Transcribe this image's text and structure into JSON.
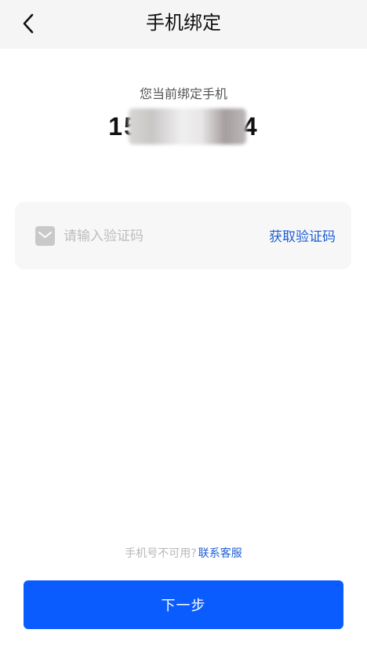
{
  "header": {
    "title": "手机绑定",
    "back_icon": "chevron-left-icon"
  },
  "bound_phone": {
    "label": "您当前绑定手机",
    "number_prefix": "15",
    "number_suffix": "4",
    "masked_icon": "blurred-redaction"
  },
  "verification": {
    "icon": "mail-icon",
    "placeholder": "请输入验证码",
    "value": "",
    "get_code_label": "获取验证码"
  },
  "help": {
    "text": "手机号不可用?",
    "link_label": "联系客服"
  },
  "actions": {
    "next_label": "下一步"
  },
  "colors": {
    "accent": "#0a5cff",
    "link": "#1f5fd6",
    "nav_background": "#f5f5f5",
    "card_background": "#f7f7f7"
  }
}
